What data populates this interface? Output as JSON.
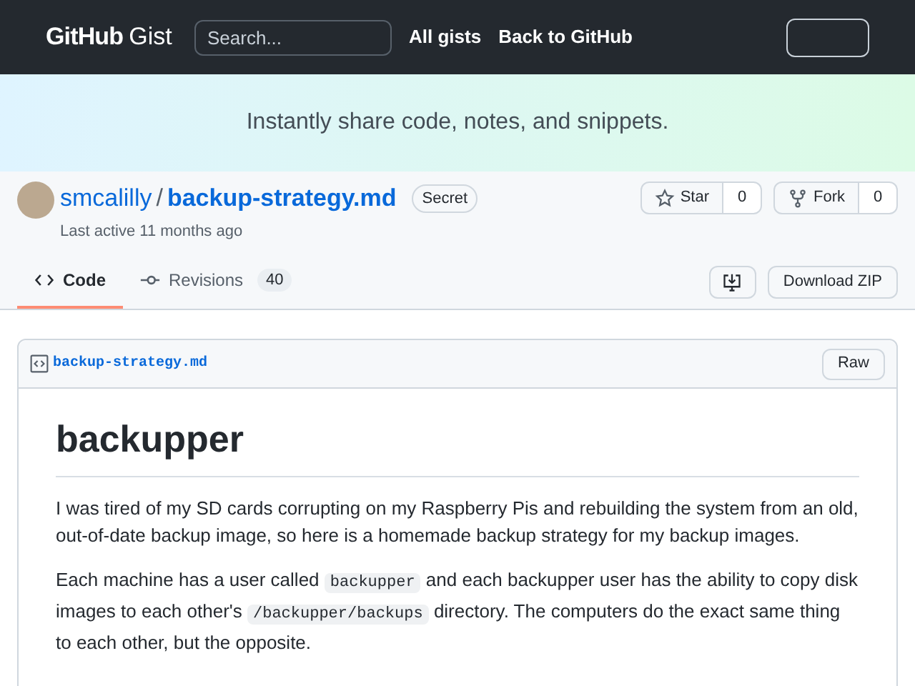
{
  "header": {
    "logo": {
      "brand": "GitHub",
      "product": "Gist"
    },
    "search": {
      "placeholder": "Search..."
    },
    "links": [
      "All gists",
      "Back to GitHub"
    ]
  },
  "banner": {
    "text": "Instantly share code, notes, and snippets."
  },
  "gist": {
    "owner": "smcalilly",
    "separator": "/",
    "filename": "backup-strategy.md",
    "badge": "Secret",
    "last_active": "Last active 11 months ago"
  },
  "actions": [
    {
      "kind": "star",
      "label": "Star",
      "count": "0"
    },
    {
      "kind": "fork",
      "label": "Fork",
      "count": "0"
    }
  ],
  "tabs": [
    {
      "kind": "code",
      "label": "Code",
      "selected": true
    },
    {
      "kind": "revisions",
      "label": "Revisions",
      "count": "40",
      "selected": false
    }
  ],
  "download": {
    "label": "Download ZIP"
  },
  "file": {
    "name": "backup-strategy.md",
    "raw": "Raw",
    "heading": "backupper",
    "paragraphs": [
      [
        {
          "kind": "text",
          "text": "I was tired of my SD cards corrupting on my Raspberry Pis and rebuilding the system from an old, out-of-date backup image, so here is a homemade backup strategy for my backup images."
        }
      ],
      [
        {
          "kind": "text",
          "text": "Each machine has a user called "
        },
        {
          "kind": "code",
          "text": "backupper"
        },
        {
          "kind": "text",
          "text": " and each backupper user has the ability to copy disk images to each other's "
        },
        {
          "kind": "code",
          "text": "/backupper/backups"
        },
        {
          "kind": "text",
          "text": " directory. The computers do the exact same thing to each other, but the opposite."
        }
      ]
    ]
  }
}
